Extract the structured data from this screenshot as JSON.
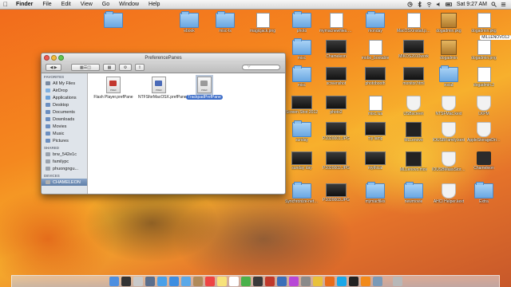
{
  "menubar": {
    "apple": "",
    "items": [
      "Finder",
      "File",
      "Edit",
      "View",
      "Go",
      "Window",
      "Help"
    ],
    "clock": "Sat 9:27 AM"
  },
  "finder": {
    "title": "PreferencePanes",
    "sidebar": {
      "favorites_header": "FAVORITES",
      "favorites": [
        "All My Files",
        "AirDrop",
        "Applications",
        "Desktop",
        "Documents",
        "Downloads",
        "Movies",
        "Music",
        "Pictures"
      ],
      "shared_header": "SHARED",
      "shared": [
        "brw_542e1c",
        "familypc",
        "phuongngu..."
      ],
      "devices_header": "DEVICES",
      "devices": [
        "CHAMELEON"
      ]
    },
    "files": [
      {
        "name": "Flash Player.prefPane",
        "badge": "PREF",
        "color": "#c2372e"
      },
      {
        "name": "NTFSforMacOSX.prefPane",
        "badge": "PREF",
        "color": "#4b6bb8"
      },
      {
        "name": "TrackpadPrefPane",
        "badge": "PREF",
        "color": "#9a9a9a"
      }
    ]
  },
  "desktop": {
    "hd_label": "MILLENOVO12",
    "icons": [
      {
        "name": "",
        "kind": "folder"
      },
      {
        "name": "ebook",
        "kind": "folder"
      },
      {
        "name": "misc-ts",
        "kind": "folder"
      },
      {
        "name": "magicjack.png",
        "kind": "doc"
      },
      {
        "name": "photo",
        "kind": "folder"
      },
      {
        "name": "mymacnewfiles.png",
        "kind": "doc"
      },
      {
        "name": "monday",
        "kind": "folder"
      },
      {
        "name": "MacOSXinstall.png",
        "kind": "doc"
      },
      {
        "name": "dogadmin.pkg",
        "kind": "pkg"
      },
      {
        "name": "dogadmin.pkg",
        "kind": "doc"
      },
      {
        "name": "misc",
        "kind": "folder"
      },
      {
        "name": "Chameleon",
        "kind": "shot"
      },
      {
        "name": "mobo_bootable",
        "kind": "doc"
      },
      {
        "name": "MIKOS2010work",
        "kind": "shot"
      },
      {
        "name": "dogadmin",
        "kind": "pkg"
      },
      {
        "name": "dogadmin.png",
        "kind": "doc"
      },
      {
        "name": "misc",
        "kind": "folder"
      },
      {
        "name": "screenshot",
        "kind": "shot"
      },
      {
        "name": "photobooth",
        "kind": "shot"
      },
      {
        "name": "monitor.html",
        "kind": "shot"
      },
      {
        "name": "install",
        "kind": "folder"
      },
      {
        "name": "dogadmin.2",
        "kind": "doc"
      },
      {
        "name": "Screen Shot 2012",
        "kind": "shot"
      },
      {
        "name": "photo2",
        "kind": "shot"
      },
      {
        "name": "misc.lua",
        "kind": "doc"
      },
      {
        "name": "USBscreen",
        "kind": "shield"
      },
      {
        "name": "NTSFMac.kext",
        "kind": "shield"
      },
      {
        "name": "LKPM",
        "kind": "shield"
      },
      {
        "name": "sunday",
        "kind": "folder"
      },
      {
        "name": "P1020001.JPG",
        "kind": "shot"
      },
      {
        "name": "my lamp",
        "kind": "shot"
      },
      {
        "name": "MLLenovo",
        "kind": "clap"
      },
      {
        "name": "IOUSBFamily.kext",
        "kind": "shield"
      },
      {
        "name": "AppleStorageDrivers.kext",
        "kind": "shield"
      },
      {
        "name": "sunday day",
        "kind": "shot"
      },
      {
        "name": "P1020002.JPG",
        "kind": "shot"
      },
      {
        "name": "mythical",
        "kind": "shot"
      },
      {
        "name": "MLLenovo.mov",
        "kind": "clap"
      },
      {
        "name": "IOUSBMassStorage.kext",
        "kind": "shield"
      },
      {
        "name": "Chameleon",
        "kind": "tool"
      },
      {
        "name": "Synchronize-networking",
        "kind": "folder"
      },
      {
        "name": "P1020003.JPG",
        "kind": "shot"
      },
      {
        "name": "mymacfiles",
        "kind": "folder"
      },
      {
        "name": "newmovie",
        "kind": "folder"
      },
      {
        "name": "AHCI Helper.kext",
        "kind": "shield"
      },
      {
        "name": "Extra",
        "kind": "folder"
      }
    ]
  },
  "dock": [
    "finder",
    "dashboard",
    "launchpad",
    "mission-control",
    "appstore",
    "safari",
    "mail",
    "contacts",
    "calendar",
    "notes",
    "reminders",
    "messages",
    "facetime",
    "photobooth",
    "iphoto",
    "itunes",
    "preferences",
    "chrome",
    "firefox",
    "skype",
    "terminal",
    "vlc",
    "utilities",
    "trash"
  ]
}
